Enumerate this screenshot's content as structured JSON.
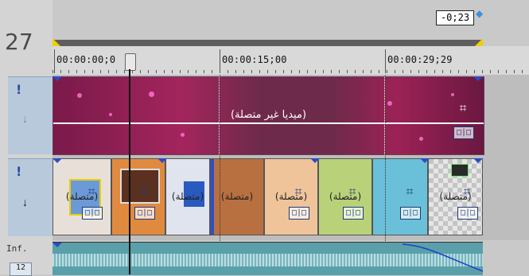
{
  "header": {
    "track_number": "27",
    "inf_label": "Inf.",
    "volume_value": "12"
  },
  "ruler": {
    "labels": [
      "00:00:00;0",
      "00:00:15;00",
      "00:00:29;29"
    ],
    "cursor_time": "-0;23"
  },
  "video_track_1": {
    "clip_label": "(ميديا غير متصلة)"
  },
  "video_track_2": {
    "thumb_labels": [
      "(متصلة)",
      "",
      "(متصلة)",
      "(متصلة)",
      "(متصلة)",
      "(متصلة)",
      "",
      "(متصلة)"
    ]
  },
  "icons": {
    "crop": "crop-icon",
    "pan": "pan-crop-icon",
    "marker": "exclamation-icon"
  },
  "colors": {
    "accent": "#3f8ee0",
    "track_header": "#b9c9dc",
    "clip": "#a3255d",
    "audio": "#5aa0aa"
  }
}
